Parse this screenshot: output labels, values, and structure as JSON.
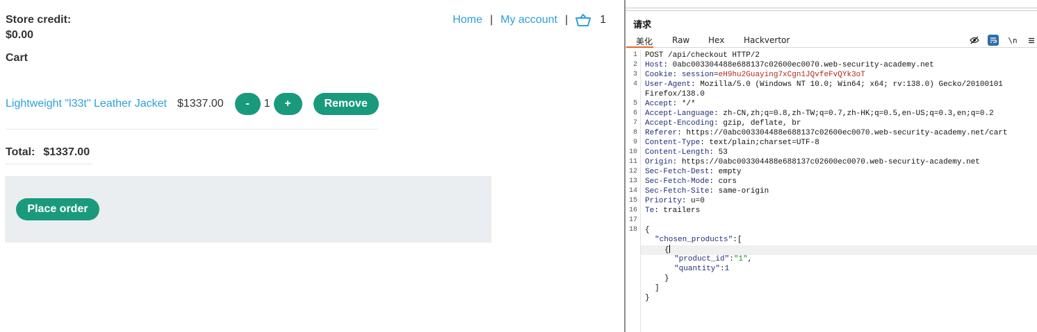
{
  "shop": {
    "store_credit_label": "Store credit:",
    "store_credit_value": "$0.00",
    "cart_heading": "Cart",
    "nav": {
      "home": "Home",
      "separator": "|",
      "my_account": "My account",
      "basket_count": "1"
    },
    "item": {
      "name": "Lightweight \"l33t\" Leather Jacket",
      "price": "$1337.00",
      "minus_label": "-",
      "quantity": "1",
      "plus_label": "+",
      "remove_label": "Remove"
    },
    "total_label": "Total:",
    "total_value": "$1337.00",
    "place_order_label": "Place order"
  },
  "burp": {
    "title": "请求",
    "tabs": [
      "美化",
      "Raw",
      "Hex",
      "Hackvertor"
    ],
    "tool_labels": {
      "newline": "\\n"
    },
    "request_line": "POST /api/checkout HTTP/2",
    "headers": [
      {
        "name": "Host",
        "value": "0abc003304488e688137c02600ec0070.web-security-academy.net"
      },
      {
        "name": "Cookie",
        "cookie_key": "session",
        "cookie_value": "eH9hu2Guaying7xCgn1JQvfeFvQYk3oT"
      },
      {
        "name": "User-Agent",
        "value": "Mozilla/5.0 (Windows NT 10.0; Win64; x64; rv:138.0) Gecko/20100101"
      },
      {
        "continuation": "Firefox/138.0"
      },
      {
        "name": "Accept",
        "value": "*/*"
      },
      {
        "name": "Accept-Language",
        "value": "zh-CN,zh;q=0.8,zh-TW;q=0.7,zh-HK;q=0.5,en-US;q=0.3,en;q=0.2"
      },
      {
        "name": "Accept-Encoding",
        "value": "gzip, deflate, br"
      },
      {
        "name": "Referer",
        "value": "https://0abc003304488e688137c02600ec0070.web-security-academy.net/cart"
      },
      {
        "name": "Content-Type",
        "value": "text/plain;charset=UTF-8"
      },
      {
        "name": "Content-Length",
        "value": "53"
      },
      {
        "name": "Origin",
        "value": "https://0abc003304488e688137c02600ec0070.web-security-academy.net"
      },
      {
        "name": "Sec-Fetch-Dest",
        "value": "empty"
      },
      {
        "name": "Sec-Fetch-Mode",
        "value": "cors"
      },
      {
        "name": "Sec-Fetch-Site",
        "value": "same-origin"
      },
      {
        "name": "Priority",
        "value": "u=0"
      },
      {
        "name": "Te",
        "value": "trailers"
      }
    ],
    "line_numbers": [
      "1",
      "2",
      "3",
      "4",
      "5",
      "6",
      "7",
      "8",
      "9",
      "10",
      "11",
      "12",
      "13",
      "14",
      "15",
      "16",
      "17",
      "18"
    ],
    "body": {
      "open_brace": "{",
      "chosen_products_key": "\"chosen_products\"",
      "open_bracket": ":[",
      "item_open": "{",
      "product_id_key": "\"product_id\"",
      "product_id_value": "\"1\"",
      "quantity_key": "\"quantity\"",
      "quantity_value": "1",
      "item_close": "}",
      "close_bracket": "]",
      "close_brace": "}"
    }
  },
  "colors": {
    "accent_green": "#1a9a7c",
    "link_blue": "#2d9fd9",
    "panel_grey": "#eaeef0",
    "burp_tab_orange": "#e8622c",
    "header_name": "#1f2e7a",
    "session_value": "#b3281e"
  }
}
